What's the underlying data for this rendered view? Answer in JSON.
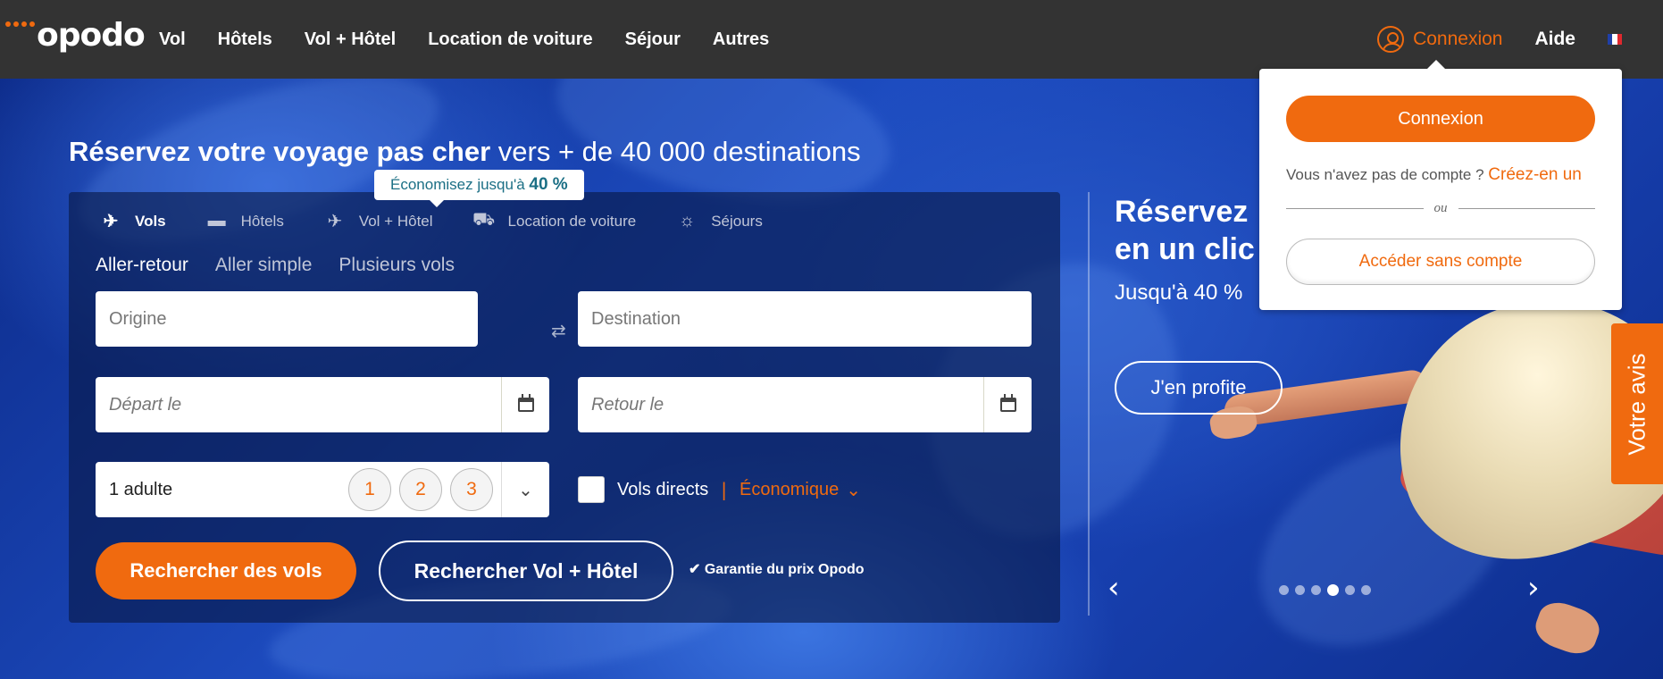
{
  "header": {
    "logo_text": "opodo",
    "nav": [
      "Vol",
      "Hôtels",
      "Vol + Hôtel",
      "Location de voiture",
      "Séjour",
      "Autres"
    ],
    "login_label": "Connexion",
    "help_label": "Aide",
    "flag_colors": [
      "#1f3fa8",
      "#ffffff",
      "#e0282e"
    ]
  },
  "hero": {
    "headline_bold": "Réservez votre voyage pas cher",
    "headline_rest": " vers + de 40 000 destinations",
    "tooltip_text": "Économisez jusqu'à ",
    "tooltip_value": "40 %"
  },
  "search": {
    "tabs": [
      {
        "label": "Vols",
        "icon": "plane-icon"
      },
      {
        "label": "Hôtels",
        "icon": "bed-icon"
      },
      {
        "label": "Vol + Hôtel",
        "icon": "plane-hotel-icon"
      },
      {
        "label": "Location de voiture",
        "icon": "car-icon"
      },
      {
        "label": "Séjours",
        "icon": "sun-icon"
      }
    ],
    "trip_types": [
      "Aller-retour",
      "Aller simple",
      "Plusieurs vols"
    ],
    "origin_placeholder": "Origine",
    "destination_placeholder": "Destination",
    "depart_placeholder": "Départ le",
    "return_placeholder": "Retour le",
    "passengers_label": "1 adulte",
    "pax_options": [
      "1",
      "2",
      "3"
    ],
    "direct_label": "Vols directs",
    "cabin_separator": "|",
    "cabin_class": "Économique",
    "search_flights_label": "Rechercher des vols",
    "search_package_label": "Rechercher Vol + Hôtel",
    "guarantee_label": "Garantie du prix Opodo"
  },
  "promo": {
    "title_line1": "Réservez",
    "title_line2": "en un clic",
    "subtitle": "Jusqu'à 40 %",
    "cta_label": "J'en profite",
    "dots_count": 6,
    "active_dot": 4
  },
  "feedback_label": "Votre avis",
  "login_popup": {
    "login_button": "Connexion",
    "no_account_text": "Vous n'avez pas de compte ? ",
    "create_link": "Créez-en un",
    "or_text": "ou",
    "guest_button": "Accéder sans compte"
  },
  "colors": {
    "accent": "#f06a0f",
    "topbar": "#333333"
  }
}
